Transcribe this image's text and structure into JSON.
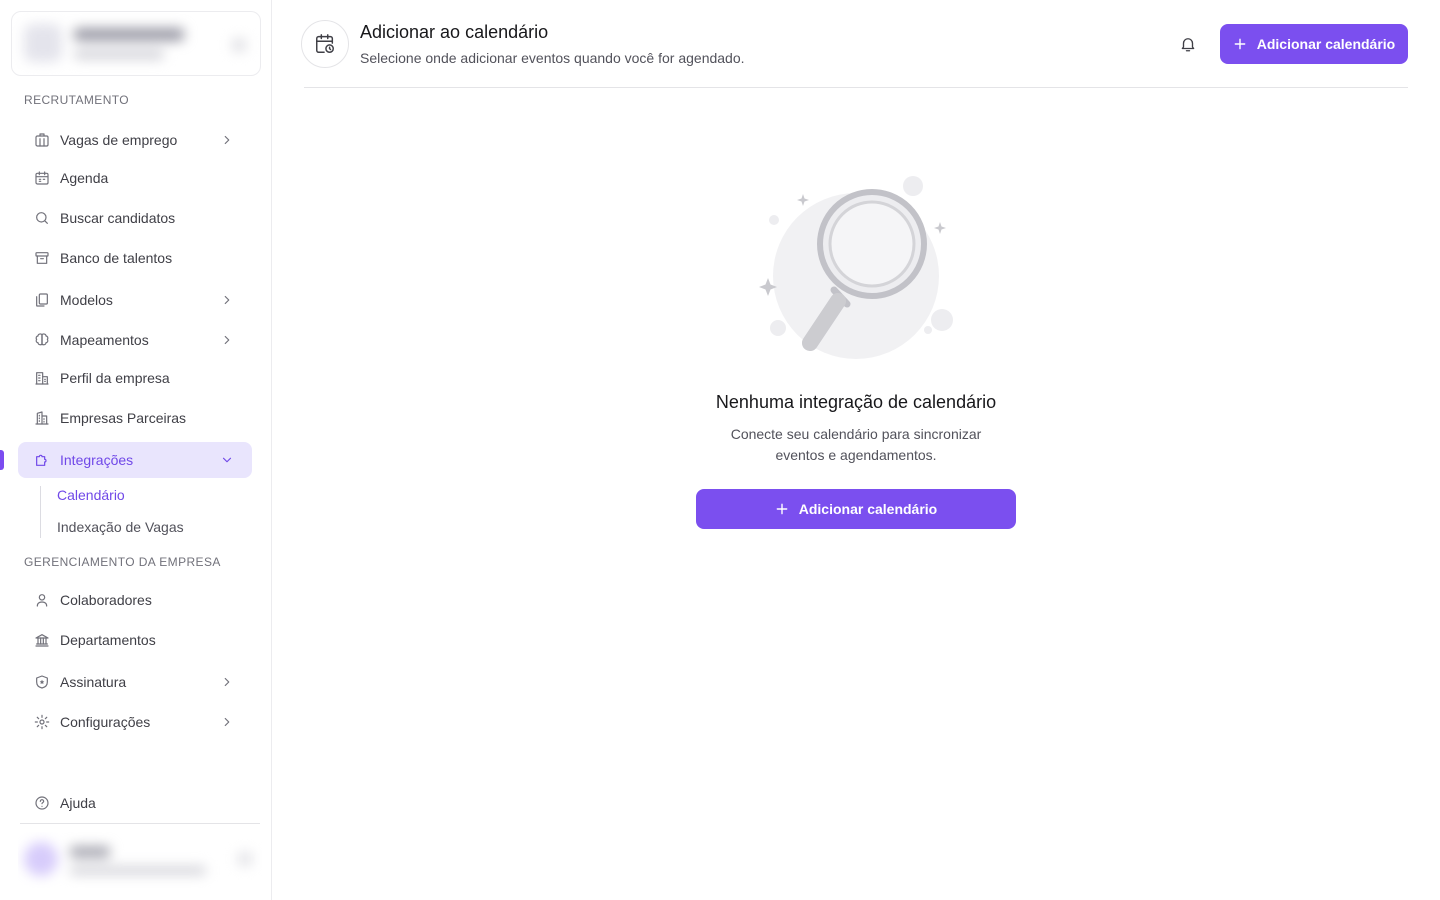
{
  "sidebar": {
    "sections": {
      "recruiting": "RECRUTAMENTO",
      "company": "GERENCIAMENTO DA EMPRESA"
    },
    "items": [
      {
        "label": "Vagas de emprego",
        "icon": "briefcase-icon",
        "expandable": true
      },
      {
        "label": "Agenda",
        "icon": "calendar-icon",
        "expandable": false
      },
      {
        "label": "Buscar candidatos",
        "icon": "search-icon",
        "expandable": false
      },
      {
        "label": "Banco de talentos",
        "icon": "archive-icon",
        "expandable": false
      },
      {
        "label": "Modelos",
        "icon": "copy-icon",
        "expandable": true
      },
      {
        "label": "Mapeamentos",
        "icon": "brain-icon",
        "expandable": true
      },
      {
        "label": "Perfil da empresa",
        "icon": "building-icon",
        "expandable": false
      },
      {
        "label": "Empresas Parceiras",
        "icon": "buildings-icon",
        "expandable": false
      },
      {
        "label": "Integrações",
        "icon": "puzzle-icon",
        "expandable": true,
        "active": true
      }
    ],
    "subitems": [
      {
        "label": "Calendário",
        "active": true
      },
      {
        "label": "Indexação de Vagas",
        "active": false
      }
    ],
    "company_items": [
      {
        "label": "Colaboradores",
        "icon": "user-icon",
        "expandable": false
      },
      {
        "label": "Departamentos",
        "icon": "bank-icon",
        "expandable": false
      },
      {
        "label": "Assinatura",
        "icon": "shield-star-icon",
        "expandable": true
      },
      {
        "label": "Configurações",
        "icon": "gear-icon",
        "expandable": true
      }
    ],
    "help": {
      "label": "Ajuda",
      "icon": "help-circle-icon"
    }
  },
  "header": {
    "icon": "calendar-clock-icon",
    "title": "Adicionar ao calendário",
    "subtitle": "Selecione onde adicionar eventos quando você for agendado.",
    "notification_icon": "bell-icon",
    "add_button": "Adicionar calendário"
  },
  "empty_state": {
    "illustration": "magnifying-glass-illustration",
    "title": "Nenhuma integração de calendário",
    "description_line1": "Conecte seu calendário para sincronizar",
    "description_line2": "eventos e agendamentos.",
    "add_button": "Adicionar calendário"
  },
  "colors": {
    "accent": "#7b4fef",
    "active_bg": "#e9e5fd",
    "active_text": "#7048e8"
  }
}
